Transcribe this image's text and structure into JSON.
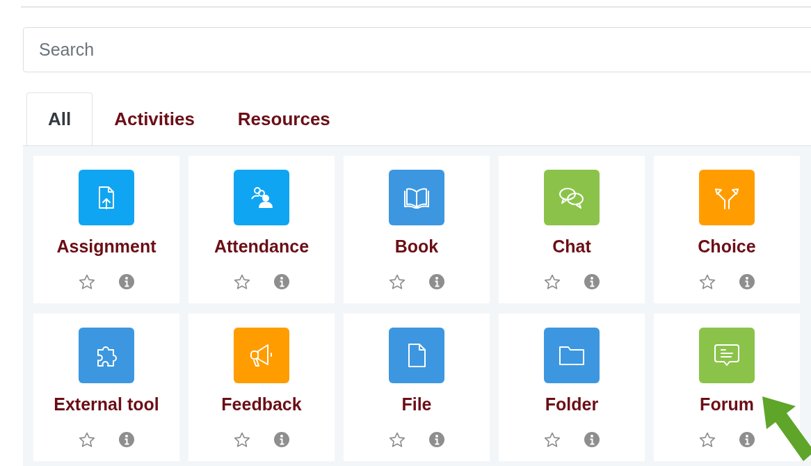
{
  "search": {
    "placeholder": "Search"
  },
  "tabs": [
    {
      "label": "All",
      "selected": true
    },
    {
      "label": "Activities",
      "selected": false
    },
    {
      "label": "Resources",
      "selected": false
    }
  ],
  "modules": [
    {
      "name": "Assignment",
      "kind": "assignment",
      "color": "#0fa5f2"
    },
    {
      "name": "Attendance",
      "kind": "attendance",
      "color": "#0fa5f2"
    },
    {
      "name": "Book",
      "kind": "book",
      "color": "#3c97e0"
    },
    {
      "name": "Chat",
      "kind": "chat",
      "color": "#8bc34a"
    },
    {
      "name": "Choice",
      "kind": "choice",
      "color": "#ff9d00"
    },
    {
      "name": "External tool",
      "kind": "puzzle",
      "color": "#3c97e0"
    },
    {
      "name": "Feedback",
      "kind": "feedback",
      "color": "#ff9d00"
    },
    {
      "name": "File",
      "kind": "file",
      "color": "#3c97e0"
    },
    {
      "name": "Folder",
      "kind": "folder",
      "color": "#3c97e0"
    },
    {
      "name": "Forum",
      "kind": "forum",
      "color": "#8bc34a"
    }
  ]
}
